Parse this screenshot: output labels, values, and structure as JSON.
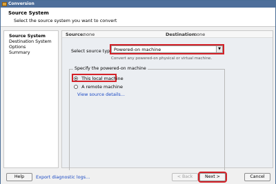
{
  "window": {
    "title": "Conversion"
  },
  "header": {
    "title": "Source System",
    "subtitle": "Select the source system you want to convert"
  },
  "sidebar": {
    "items": [
      {
        "label": "Source System",
        "active": true
      },
      {
        "label": "Destination System",
        "active": false
      },
      {
        "label": "Options",
        "active": false
      },
      {
        "label": "Summary",
        "active": false
      }
    ]
  },
  "source_row": {
    "source_label": "Source:",
    "source_value": "none",
    "destination_label": "Destination:",
    "destination_value": "none"
  },
  "source_type": {
    "label": "Select source type:",
    "selected": "Powered-on machine",
    "hint": "Convert any powered-on physical or virtual machine."
  },
  "powered_on_group": {
    "legend": "Specify the powered-on machine",
    "options": [
      {
        "label": "This local machine",
        "checked": true
      },
      {
        "label": "A remote machine",
        "checked": false
      }
    ],
    "view_details_link": "View source details..."
  },
  "footer": {
    "help_label": "Help",
    "export_link": "Export diagnostic logs...",
    "back_label": "< Back",
    "next_label": "Next >",
    "cancel_label": "Cancel"
  },
  "colors": {
    "title_bar": "#4e6f9b",
    "highlight_red": "#d42027",
    "link_blue": "#1a49c4"
  }
}
